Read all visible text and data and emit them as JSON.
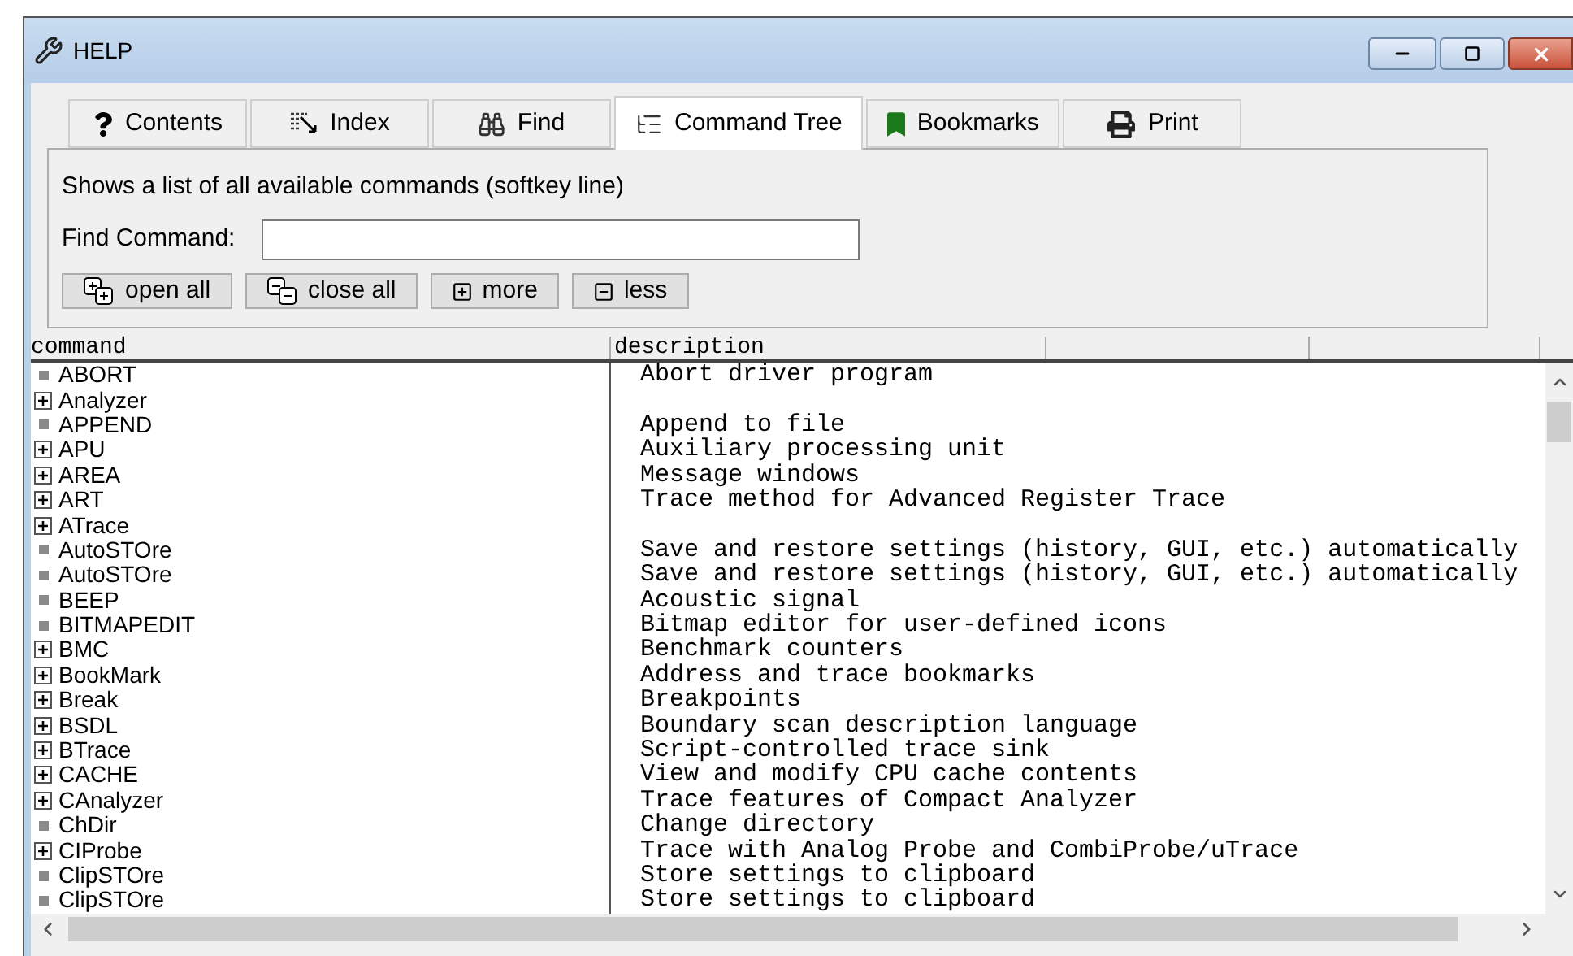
{
  "window": {
    "title": "HELP"
  },
  "tabs": [
    {
      "label": "Contents",
      "kind": "help",
      "selected": false
    },
    {
      "label": "Index",
      "kind": "index",
      "selected": false
    },
    {
      "label": "Find",
      "kind": "find",
      "selected": false
    },
    {
      "label": "Command Tree",
      "kind": "tree",
      "selected": true
    },
    {
      "label": "Bookmarks",
      "kind": "bookmark",
      "selected": false
    },
    {
      "label": "Print",
      "kind": "print",
      "selected": false
    }
  ],
  "panel": {
    "description": "Shows a list of all available commands (softkey line)",
    "find_label": "Find Command:",
    "buttons": [
      {
        "label": "open all",
        "kind": "open_all"
      },
      {
        "label": "close all",
        "kind": "close_all"
      },
      {
        "label": "more",
        "kind": "more"
      },
      {
        "label": "less",
        "kind": "less"
      }
    ]
  },
  "table": {
    "columns": [
      "command",
      "description"
    ],
    "rows": [
      {
        "command": "ABORT",
        "kind": "command",
        "description": "Abort driver program"
      },
      {
        "command": "Analyzer",
        "kind": "group",
        "description": ""
      },
      {
        "command": "APPEND",
        "kind": "command",
        "description": "Append to file"
      },
      {
        "command": "APU",
        "kind": "group",
        "description": "Auxiliary processing unit"
      },
      {
        "command": "AREA",
        "kind": "group",
        "description": "Message windows"
      },
      {
        "command": "ART",
        "kind": "group",
        "description": "Trace method for Advanced Register Trace"
      },
      {
        "command": "ATrace",
        "kind": "group",
        "description": ""
      },
      {
        "command": "AutoSTOre",
        "kind": "command",
        "description": "Save and restore settings (history, GUI, etc.) automatically"
      },
      {
        "command": "AutoSTOre",
        "kind": "command",
        "description": "Save and restore settings (history, GUI, etc.) automatically"
      },
      {
        "command": "BEEP",
        "kind": "command",
        "description": "Acoustic signal"
      },
      {
        "command": "BITMAPEDIT",
        "kind": "command",
        "description": "Bitmap editor for user-defined icons"
      },
      {
        "command": "BMC",
        "kind": "group",
        "description": "Benchmark counters"
      },
      {
        "command": "BookMark",
        "kind": "group",
        "description": "Address and trace bookmarks"
      },
      {
        "command": "Break",
        "kind": "group",
        "description": "Breakpoints"
      },
      {
        "command": "BSDL",
        "kind": "group",
        "description": "Boundary scan description language"
      },
      {
        "command": "BTrace",
        "kind": "group",
        "description": "Script-controlled trace sink"
      },
      {
        "command": "CACHE",
        "kind": "group",
        "description": "View and modify CPU cache contents"
      },
      {
        "command": "CAnalyzer",
        "kind": "group",
        "description": "Trace features of Compact Analyzer"
      },
      {
        "command": "ChDir",
        "kind": "command",
        "description": "Change directory"
      },
      {
        "command": "CIProbe",
        "kind": "group",
        "description": "Trace with Analog Probe and CombiProbe/uTrace"
      },
      {
        "command": "ClipSTOre",
        "kind": "command",
        "description": "Store settings to clipboard"
      },
      {
        "command": "ClipSTOre",
        "kind": "command",
        "description": "Store settings to clipboard"
      }
    ]
  }
}
